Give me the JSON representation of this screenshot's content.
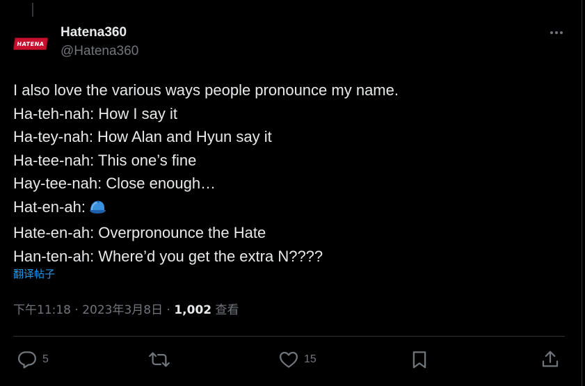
{
  "post": {
    "author": {
      "name": "Hatena360",
      "handle": "@Hatena360",
      "avatar_text": "HATENA"
    },
    "text_lines": [
      "I also love the various ways people pronounce my name.",
      "Ha-teh-nah: How I say it",
      "Ha-tey-nah: How Alan and Hyun say it",
      "Ha-tee-nah: This one’s fine",
      "Hay-tee-nah: Close enough…",
      "Hat-en-ah:",
      "Hate-en-ah: Overpronounce the Hate",
      "Han-ten-ah: Where’d you get the extra N????"
    ],
    "emoji_after_line_6": "blue-cap-icon",
    "translate_label": "翻译帖子",
    "time": "下午11:18",
    "separator": " · ",
    "date": "2023年3月8日",
    "views_count": "1,002",
    "views_label": "查看"
  },
  "actions": {
    "replies": "5",
    "reposts": "",
    "likes": "15"
  },
  "colors": {
    "background": "#000000",
    "text": "#e7e9ea",
    "secondary": "#71767b",
    "accent": "#1d9bf0",
    "divider": "#2f3336",
    "avatar_badge": "#c8102e"
  },
  "icons": [
    "more-icon",
    "reply-icon",
    "repost-icon",
    "like-icon",
    "bookmark-icon",
    "share-icon",
    "blue-cap-icon"
  ]
}
